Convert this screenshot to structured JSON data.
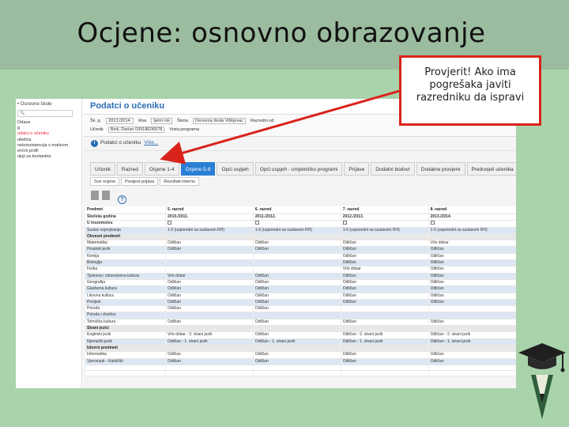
{
  "slide": {
    "title": "Ocjene: osnovno obrazovanje",
    "callout_lines": [
      "Provjerit! Ako ima",
      "pogrešaka javiti",
      "razredniku da ispravi"
    ],
    "colors": {
      "band": "#9bbc9f",
      "body": "#a9d3ab",
      "callout_border": "#d9231b"
    }
  },
  "sidebar": {
    "top": "• Osnovne škole",
    "items": [
      {
        "label": "Odava",
        "active": false
      },
      {
        "label": "g",
        "active": false
      },
      {
        "label": "",
        "active": false
      },
      {
        "label": "",
        "active": false
      },
      {
        "label": "odatci o učeniku",
        "active": true
      },
      {
        "label": "ubelića",
        "active": false
      },
      {
        "label": "nekonzistencija s maticom",
        "active": false
      },
      {
        "label": "enčni profil",
        "active": false
      },
      {
        "label": "ojnji za kontanika",
        "active": false
      }
    ]
  },
  "app": {
    "header_title": "Podatci o učeniku",
    "filters": {
      "row1": [
        "Šk. g.",
        "2013./2014.",
        "Roa",
        "Ijetni rok",
        "Škola",
        "Osnovna škola Viškjevac",
        "Razredni od"
      ],
      "row2": [
        "Učenik",
        "Bioli, Darian 03918E06578",
        "Vrsta programa"
      ]
    },
    "info_label": "Podatci o učeniku",
    "info_link": "Više...",
    "tabs": [
      {
        "label": "Učenik",
        "active": false
      },
      {
        "label": "Razred",
        "active": false
      },
      {
        "label": "Ocjene 1-4",
        "active": false
      },
      {
        "label": "Ocjene 5-8",
        "active": true
      },
      {
        "label": "Opći uspjeh",
        "active": false
      },
      {
        "label": "Opći uspjeh - umjetničko programi",
        "active": false
      },
      {
        "label": "Prijave",
        "active": false
      },
      {
        "label": "Dodatni bodovi",
        "active": false
      },
      {
        "label": "Dodatne provjere",
        "active": false
      },
      {
        "label": "Preduvjeti učenika",
        "active": false
      },
      {
        "label": "Rezultati",
        "active": false
      }
    ],
    "subtabs": [
      "Sve ocjene",
      "Povijest prijava",
      "Rezultati interno"
    ],
    "help_icon": "?",
    "table": {
      "columns": [
        "Predmet",
        "5. razred",
        "6. razred",
        "7. razred",
        "8. razred"
      ],
      "rows": [
        {
          "type": "normal",
          "cells": [
            "Školska godina",
            "2010./2011.",
            "2011./2012.",
            "2012./2013.",
            "2013./2014."
          ],
          "bold": true
        },
        {
          "type": "normal",
          "cells": [
            "U inozemstvu",
            "☐",
            "☐",
            "☐",
            "☐"
          ],
          "bold": true
        },
        {
          "type": "alt",
          "cells": [
            "Sustav ocjenjivanja",
            "1-5 (usporedni sa sustavom RH)",
            "1-5 (usporedni sa sustavom RH)",
            "1-5 (usporedni sa sustavom RH)",
            "1-5 (usporedni sa sustavom RH)"
          ]
        },
        {
          "type": "sec",
          "cells": [
            "Obvezni predmeti",
            "",
            "",
            "",
            ""
          ]
        },
        {
          "type": "normal",
          "cells": [
            "Matematika",
            "Odličan",
            "Odličan",
            "Odličan",
            "Vrlo dobar"
          ]
        },
        {
          "type": "alt",
          "cells": [
            "Hrvatski jezik",
            "Odličan",
            "Odličan",
            "Odličan",
            "Odličan"
          ]
        },
        {
          "type": "normal",
          "cells": [
            "Kemija",
            "",
            "",
            "Odličan",
            "Odličan"
          ]
        },
        {
          "type": "alt",
          "cells": [
            "Biologija",
            "",
            "",
            "Odličan",
            "Odličan"
          ]
        },
        {
          "type": "normal",
          "cells": [
            "Fizika",
            "",
            "",
            "Vrlo dobar",
            "Odličan"
          ]
        },
        {
          "type": "alt",
          "cells": [
            "Tjelesna i zdravstvena kultura",
            "Vrlo dobar",
            "Odličan",
            "Odličan",
            "Odličan"
          ]
        },
        {
          "type": "normal",
          "cells": [
            "Geografija",
            "Odličan",
            "Odličan",
            "Odličan",
            "Odličan"
          ]
        },
        {
          "type": "alt",
          "cells": [
            "Glazbena kultura",
            "Odličan",
            "Odličan",
            "Odličan",
            "Odličan"
          ]
        },
        {
          "type": "normal",
          "cells": [
            "Likovna kultura",
            "Odličan",
            "Odličan",
            "Odličan",
            "Odličan"
          ]
        },
        {
          "type": "alt",
          "cells": [
            "Povijest",
            "Odličan",
            "Odličan",
            "Odličan",
            "Odličan"
          ]
        },
        {
          "type": "normal",
          "cells": [
            "Priroda",
            "Odličan",
            "Odličan",
            "",
            ""
          ]
        },
        {
          "type": "alt",
          "cells": [
            "Priroda i društvo",
            "",
            "",
            "",
            ""
          ]
        },
        {
          "type": "normal",
          "cells": [
            "Tehnička kultura",
            "Odličan",
            "Odličan",
            "Odličan",
            "Odličan"
          ]
        },
        {
          "type": "sec",
          "cells": [
            "Strani jezici",
            "",
            "",
            "",
            ""
          ]
        },
        {
          "type": "normal",
          "cells": [
            "Engleski jezik",
            "Vrlo dobar - 2. strani jezik",
            "Odličan",
            "Odličan - 2. strani jezik",
            "Odličan - 2. strani jezik"
          ]
        },
        {
          "type": "alt",
          "cells": [
            "Njemački jezik",
            "Odličan - 1. strani jezik",
            "Odličan - 1. strani jezik",
            "Odličan - 1. strani jezik",
            "Odličan - 1. strani jezik"
          ]
        },
        {
          "type": "sec",
          "cells": [
            "Izborni predmeti",
            "",
            "",
            "",
            ""
          ]
        },
        {
          "type": "normal",
          "cells": [
            "Informatika",
            "Odličan",
            "Odličan",
            "Odličan",
            "Odličan"
          ]
        },
        {
          "type": "alt",
          "cells": [
            "Vjeronauk - Katolički",
            "Odličan",
            "Odličan",
            "Odličan",
            "Odličan"
          ]
        },
        {
          "type": "normal",
          "cells": [
            "",
            "",
            "",
            "",
            ""
          ]
        },
        {
          "type": "normal",
          "cells": [
            "",
            "",
            "",
            "",
            ""
          ]
        }
      ]
    }
  },
  "icons": {
    "logo": "graduation-cap-pencil-icon",
    "info": "info-icon",
    "help": "help-icon"
  }
}
